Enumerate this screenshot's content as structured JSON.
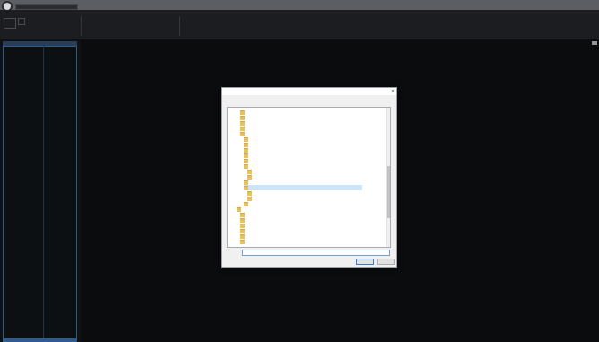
{
  "app": {
    "window_title": "",
    "menu": [
      "",
      "",
      "",
      "",
      ""
    ],
    "ribbon_groups": [
      {
        "label": ""
      },
      {
        "label": ""
      },
      {
        "label": ""
      },
      {
        "label": ""
      },
      {
        "label": ""
      }
    ]
  },
  "left_panel": {
    "rows": [
      "",
      ""
    ]
  },
  "dialog": {
    "title": "",
    "description": "",
    "folder_label": "",
    "folder_value": "",
    "new_folder_label": "",
    "ok_label": "",
    "cancel_label": "",
    "tree_nodes": [
      {
        "label": ""
      },
      {
        "label": ""
      },
      {
        "label": ""
      },
      {
        "label": ""
      },
      {
        "label": ""
      },
      {
        "label": ""
      },
      {
        "label": ""
      },
      {
        "label": ""
      },
      {
        "label": ""
      },
      {
        "label": ""
      },
      {
        "label": ""
      },
      {
        "label": ""
      },
      {
        "label": ""
      },
      {
        "label": ""
      },
      {
        "label": ""
      },
      {
        "label": ""
      },
      {
        "label": ""
      },
      {
        "label": ""
      },
      {
        "label": ""
      },
      {
        "label": ""
      },
      {
        "label": ""
      },
      {
        "label": ""
      },
      {
        "label": ""
      },
      {
        "label": ""
      },
      {
        "label": ""
      }
    ],
    "selected_index": 14
  }
}
